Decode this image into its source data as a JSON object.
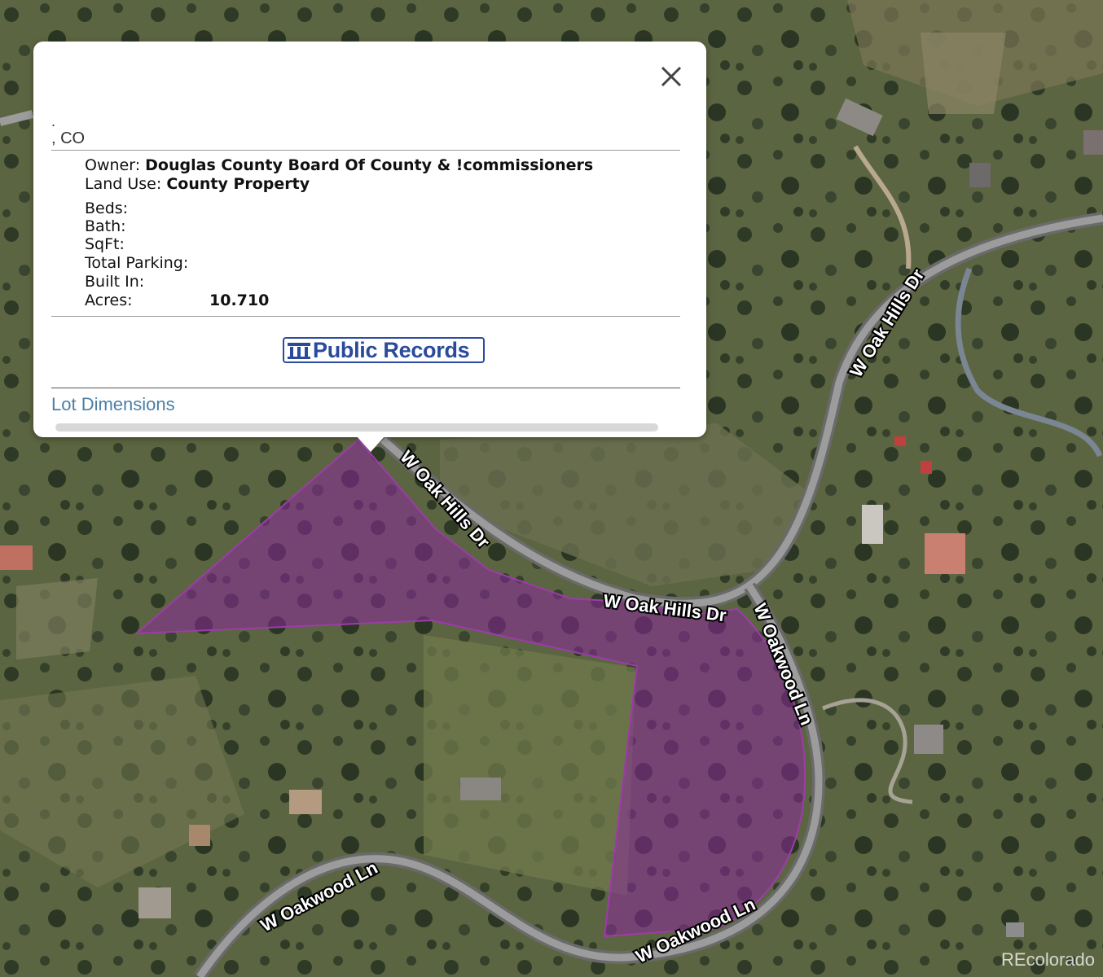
{
  "map": {
    "roads": {
      "oak_hills_upper": "W Oak Hills Dr",
      "oak_hills_diag": "W Oak Hills Dr",
      "oak_hills_lower": "W Oak Hills Dr",
      "oakwood_vertical": "W Oakwood Ln",
      "oakwood_left": "W Oakwood Ln",
      "oakwood_bottom": "W Oakwood Ln"
    },
    "parcel_color": "#8a2a9a",
    "watermark": "REcolorado"
  },
  "popup": {
    "address_line1": ".",
    "address_line2": ", CO",
    "owner_label": "Owner:",
    "owner_value": "Douglas County Board Of County & !commissioners",
    "land_use_label": "Land Use:",
    "land_use_value": "County Property",
    "beds_label": "Beds:",
    "bath_label": "Bath:",
    "sqft_label": "SqFt:",
    "parking_label": "Total Parking:",
    "built_label": "Built In:",
    "acres_label": "Acres:",
    "acres_value": "10.710",
    "public_records_label": "Public Records",
    "lot_dimensions_label": "Lot Dimensions"
  }
}
